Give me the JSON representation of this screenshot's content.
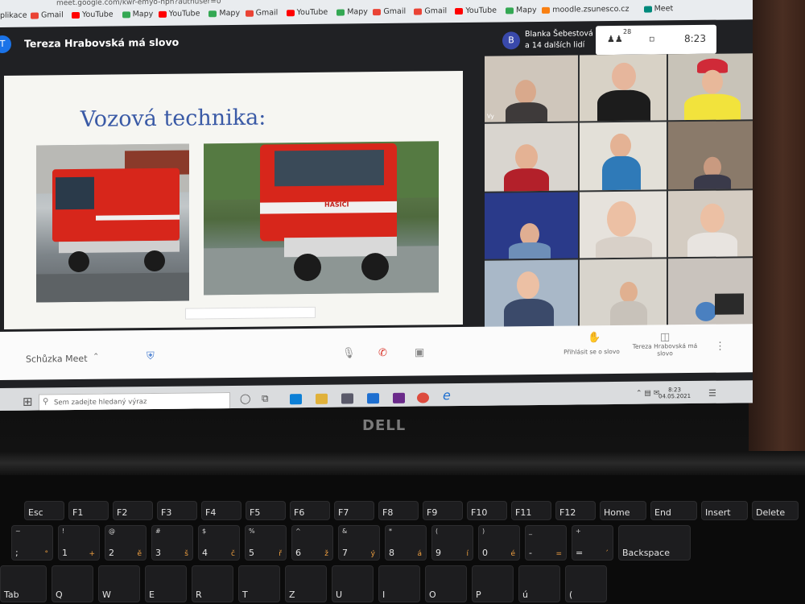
{
  "browser": {
    "url": "meet.google.com/kwr-emyo-hph?authuser=0",
    "bookmarks": [
      {
        "label": "plikace",
        "color": "#4285f4"
      },
      {
        "label": "Gmail",
        "color": "#ea4335"
      },
      {
        "label": "YouTube",
        "color": "#ff0000"
      },
      {
        "label": "Mapy",
        "color": "#34a853"
      },
      {
        "label": "YouTube",
        "color": "#ff0000"
      },
      {
        "label": "Mapy",
        "color": "#34a853"
      },
      {
        "label": "Gmail",
        "color": "#ea4335"
      },
      {
        "label": "YouTube",
        "color": "#ff0000"
      },
      {
        "label": "Mapy",
        "color": "#34a853"
      },
      {
        "label": "Gmail",
        "color": "#ea4335"
      },
      {
        "label": "Gmail",
        "color": "#ea4335"
      },
      {
        "label": "YouTube",
        "color": "#ff0000"
      },
      {
        "label": "Mapy",
        "color": "#34a853"
      },
      {
        "label": "moodle.zsunesco.cz",
        "color": "#f98012"
      },
      {
        "label": "Meet",
        "color": "#00897b"
      }
    ]
  },
  "meet": {
    "title": "Tereza Hrabovská má slovo",
    "avatar_letter": "T",
    "presenter_avatar": "B",
    "presenter_name": "Blanka Šebestová",
    "presenter_sub": "a 14 dalších lidí",
    "participants_count": "28",
    "time": "8:23",
    "self_label": "Vy",
    "bottom_label": "Schůzka Meet",
    "raise_hand": "Přihlásit se o slovo",
    "presenting_label": "Tereza Hrabovská má slovo"
  },
  "slide": {
    "title": "Vozová technika:",
    "truck_text": "HASIČI"
  },
  "taskbar": {
    "search_placeholder": "Sem zadejte hledaný výraz",
    "clock_time": "8:23",
    "clock_date": "04.05.2021"
  },
  "laptop": {
    "brand": "DELL"
  },
  "keyboard": {
    "frow": [
      "Esc",
      "F1",
      "F2",
      "F3",
      "F4",
      "F5",
      "F6",
      "F7",
      "F8",
      "F9",
      "F10",
      "F11",
      "F12",
      "Home",
      "End",
      "Insert",
      "Delete"
    ],
    "numrow": [
      {
        "top": "~",
        "main": ";",
        "alt": "°"
      },
      {
        "top": "!",
        "main": "1",
        "alt": "+"
      },
      {
        "top": "@",
        "main": "2",
        "alt": "ě"
      },
      {
        "top": "#",
        "main": "3",
        "alt": "š"
      },
      {
        "top": "$",
        "main": "4",
        "alt": "č"
      },
      {
        "top": "%",
        "main": "5",
        "alt": "ř"
      },
      {
        "top": "^",
        "main": "6",
        "alt": "ž"
      },
      {
        "top": "&",
        "main": "7",
        "alt": "ý"
      },
      {
        "top": "*",
        "main": "8",
        "alt": "á"
      },
      {
        "top": "(",
        "main": "9",
        "alt": "í"
      },
      {
        "top": ")",
        "main": "0",
        "alt": "é"
      },
      {
        "top": "_",
        "main": "-",
        "alt": "="
      },
      {
        "top": "+",
        "main": "=",
        "alt": "´"
      },
      {
        "top": "",
        "main": "Backspace",
        "alt": ""
      }
    ],
    "qrow": [
      "Tab",
      "Q",
      "W",
      "E",
      "R",
      "T",
      "Z",
      "U",
      "I",
      "O",
      "P",
      "ú",
      "("
    ]
  }
}
